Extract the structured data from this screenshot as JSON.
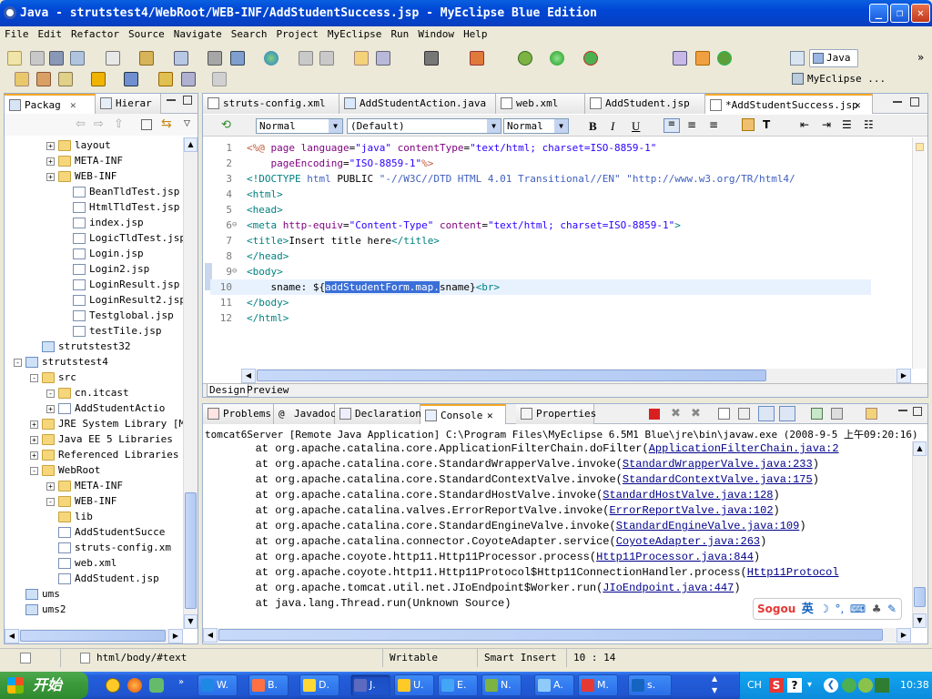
{
  "window": {
    "title": "Java - strutstest4/WebRoot/WEB-INF/AddStudentSuccess.jsp - MyEclipse Blue Edition"
  },
  "menu": [
    "File",
    "Edit",
    "Refactor",
    "Source",
    "Navigate",
    "Search",
    "Project",
    "MyEclipse",
    "Run",
    "Window",
    "Help"
  ],
  "perspectives": {
    "java": "Java",
    "myeclipse": "MyEclipse ..."
  },
  "left_tabs": {
    "packag": "Packag",
    "hierar": "Hierar"
  },
  "tree": [
    {
      "label": "layout",
      "indent": 3,
      "type": "folder",
      "exp": "+"
    },
    {
      "label": "META-INF",
      "indent": 3,
      "type": "folder",
      "exp": "+"
    },
    {
      "label": "WEB-INF",
      "indent": 3,
      "type": "folder",
      "exp": "+"
    },
    {
      "label": "BeanTldTest.jsp",
      "indent": 4,
      "type": "file"
    },
    {
      "label": "HtmlTldTest.jsp",
      "indent": 4,
      "type": "file"
    },
    {
      "label": "index.jsp",
      "indent": 4,
      "type": "file"
    },
    {
      "label": "LogicTldTest.jsp",
      "indent": 4,
      "type": "file"
    },
    {
      "label": "Login.jsp",
      "indent": 4,
      "type": "file"
    },
    {
      "label": "Login2.jsp",
      "indent": 4,
      "type": "file"
    },
    {
      "label": "LoginResult.jsp",
      "indent": 4,
      "type": "file"
    },
    {
      "label": "LoginResult2.jsp",
      "indent": 4,
      "type": "file"
    },
    {
      "label": "Testglobal.jsp",
      "indent": 4,
      "type": "file"
    },
    {
      "label": "testTile.jsp",
      "indent": 4,
      "type": "file"
    },
    {
      "label": "strutstest32",
      "indent": 1,
      "type": "proj"
    },
    {
      "label": "strutstest4",
      "indent": 0,
      "type": "proj",
      "exp": "-"
    },
    {
      "label": "src",
      "indent": 1,
      "type": "folder",
      "exp": "-"
    },
    {
      "label": "cn.itcast",
      "indent": 2,
      "type": "folder",
      "exp": "-"
    },
    {
      "label": "AddStudentActio",
      "indent": 3,
      "type": "file",
      "exp": "+"
    },
    {
      "label": "JRE System Library [My",
      "indent": 1,
      "type": "folder",
      "exp": "+"
    },
    {
      "label": "Java EE 5 Libraries",
      "indent": 1,
      "type": "folder",
      "exp": "+"
    },
    {
      "label": "Referenced Libraries",
      "indent": 1,
      "type": "folder",
      "exp": "+"
    },
    {
      "label": "WebRoot",
      "indent": 1,
      "type": "folder",
      "exp": "-"
    },
    {
      "label": "META-INF",
      "indent": 2,
      "type": "folder",
      "exp": "+"
    },
    {
      "label": "WEB-INF",
      "indent": 2,
      "type": "folder",
      "exp": "-"
    },
    {
      "label": "lib",
      "indent": 3,
      "type": "folder"
    },
    {
      "label": "AddStudentSucce",
      "indent": 3,
      "type": "file"
    },
    {
      "label": "struts-config.xm",
      "indent": 3,
      "type": "file"
    },
    {
      "label": "web.xml",
      "indent": 3,
      "type": "file"
    },
    {
      "label": "AddStudent.jsp",
      "indent": 2,
      "type": "file"
    },
    {
      "label": "ums",
      "indent": 0,
      "type": "proj"
    },
    {
      "label": "ums2",
      "indent": 0,
      "type": "proj"
    }
  ],
  "editor_tabs": [
    "struts-config.xml",
    "AddStudentAction.java",
    "web.xml",
    "AddStudent.jsp",
    "*AddStudentSuccess.jsp"
  ],
  "format_toolbar": {
    "para": "Normal",
    "font": "(Default)",
    "size": "Normal",
    "bold": "B",
    "italic": "I",
    "underline": "U"
  },
  "code_lines": [
    {
      "n": "1",
      "html": "<span class='jsp'>&lt;%@</span> <span class='attr'>page</span> <span class='attr'>language</span>=<span class='val'>\"java\"</span> <span class='attr'>contentType</span>=<span class='val'>\"text/html; charset=ISO-8859-1\"</span>"
    },
    {
      "n": "2",
      "html": "    <span class='attr'>pageEncoding</span>=<span class='val'>\"ISO-8859-1\"</span><span class='jsp'>%&gt;</span>"
    },
    {
      "n": "3",
      "html": "<span class='tag'>&lt;!DOCTYPE</span> <span class='dt'>html</span> PUBLIC <span class='dt'>\"-//W3C//DTD HTML 4.01 Transitional//EN\"</span> <span class='dt'>\"http://www.w3.org/TR/html4/</span>"
    },
    {
      "n": "4",
      "html": "<span class='tag'>&lt;html&gt;</span>"
    },
    {
      "n": "5",
      "html": "<span class='tag'>&lt;head&gt;</span>"
    },
    {
      "n": "6",
      "html": "<span class='tag'>&lt;meta</span> <span class='attr'>http-equiv</span>=<span class='val'>\"Content-Type\"</span> <span class='attr'>content</span>=<span class='val'>\"text/html; charset=ISO-8859-1\"</span><span class='tag'>&gt;</span>"
    },
    {
      "n": "7",
      "html": "<span class='tag'>&lt;title&gt;</span>Insert title here<span class='tag'>&lt;/title&gt;</span>"
    },
    {
      "n": "8",
      "html": "<span class='tag'>&lt;/head&gt;</span>"
    },
    {
      "n": "9",
      "html": "<span class='tag'>&lt;body&gt;</span>"
    },
    {
      "n": "10",
      "html": "    sname: ${<span style='background:#3a6fd8;color:#fff'>addStudentForm.map.</span>sname}<span class='tag'>&lt;br&gt;</span>"
    },
    {
      "n": "11",
      "html": "<span class='tag'>&lt;/body&gt;</span>"
    },
    {
      "n": "12",
      "html": "<span class='tag'>&lt;/html&gt;</span>"
    }
  ],
  "editor_bottom_tabs": {
    "design": "Design",
    "preview": "Preview"
  },
  "bottom_tabs": [
    "Problems",
    "Javadoc",
    "Declaration",
    "Console",
    "Properties"
  ],
  "console": {
    "header": "tomcat6Server [Remote Java Application] C:\\Program Files\\MyEclipse 6.5M1 Blue\\jre\\bin\\javaw.exe (2008-9-5 上午09:20:16)",
    "lines": [
      {
        "t": "        at org.apache.catalina.core.ApplicationFilterChain.doFilter(",
        "l": "ApplicationFilterChain.java:2"
      },
      {
        "t": "        at org.apache.catalina.core.StandardWrapperValve.invoke(",
        "l": "StandardWrapperValve.java:233",
        "e": ")"
      },
      {
        "t": "        at org.apache.catalina.core.StandardContextValve.invoke(",
        "l": "StandardContextValve.java:175",
        "e": ")"
      },
      {
        "t": "        at org.apache.catalina.core.StandardHostValve.invoke(",
        "l": "StandardHostValve.java:128",
        "e": ")"
      },
      {
        "t": "        at org.apache.catalina.valves.ErrorReportValve.invoke(",
        "l": "ErrorReportValve.java:102",
        "e": ")"
      },
      {
        "t": "        at org.apache.catalina.core.StandardEngineValve.invoke(",
        "l": "StandardEngineValve.java:109",
        "e": ")"
      },
      {
        "t": "        at org.apache.catalina.connector.CoyoteAdapter.service(",
        "l": "CoyoteAdapter.java:263",
        "e": ")"
      },
      {
        "t": "        at org.apache.coyote.http11.Http11Processor.process(",
        "l": "Http11Processor.java:844",
        "e": ")"
      },
      {
        "t": "        at org.apache.coyote.http11.Http11Protocol$Http11ConnectionHandler.process(",
        "l": "Http11Protocol"
      },
      {
        "t": "        at org.apache.tomcat.util.net.JIoEndpoint$Worker.run(",
        "l": "JIoEndpoint.java:447",
        "e": ")"
      },
      {
        "t": "        at java.lang.Thread.run(Unknown Source)"
      }
    ]
  },
  "ime": {
    "label": "Sogou",
    "mode": "英"
  },
  "status": {
    "path": "html/body/#text",
    "writable": "Writable",
    "insert": "Smart Insert",
    "pos": "10 : 14"
  },
  "taskbar": {
    "start": "开始",
    "tasks": [
      "W.",
      "B.",
      "D.",
      "J.",
      "U.",
      "E.",
      "N.",
      "A.",
      "M.",
      "s."
    ],
    "lang": "CH",
    "clock": "10:38"
  }
}
